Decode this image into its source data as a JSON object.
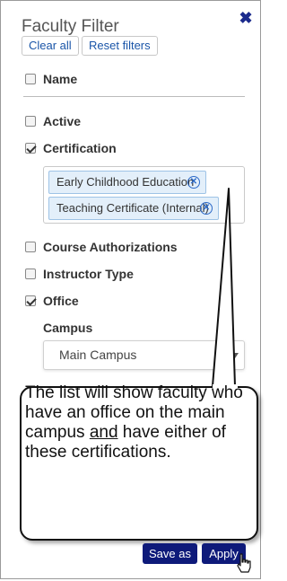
{
  "panel": {
    "title": "Faculty Filter",
    "close_icon": "close-icon"
  },
  "toolbar": {
    "clear_all_label": "Clear all",
    "reset_filters_label": "Reset filters"
  },
  "filters": [
    {
      "label": "Name",
      "checked": false
    },
    {
      "label": "Active",
      "checked": false
    },
    {
      "label": "Certification",
      "checked": true
    },
    {
      "label": "Course Authorizations",
      "checked": false
    },
    {
      "label": "Instructor Type",
      "checked": false
    },
    {
      "label": "Office",
      "checked": true
    }
  ],
  "certification_tags": [
    {
      "label": "Early Childhood Education"
    },
    {
      "label": "Teaching Certificate (Internal)"
    }
  ],
  "office": {
    "campus_label": "Campus",
    "campus_value": "Main Campus"
  },
  "callout": {
    "text_before": "The list will show faculty who have an office on the main campus ",
    "text_underlined": "and",
    "text_after": " have either of these certifications."
  },
  "footer": {
    "save_as_label": "Save as",
    "apply_label": "Apply"
  },
  "colors": {
    "accent_dark": "#0e1a7a",
    "link_blue": "#1a55a8",
    "tag_bg": "#e3effa"
  }
}
